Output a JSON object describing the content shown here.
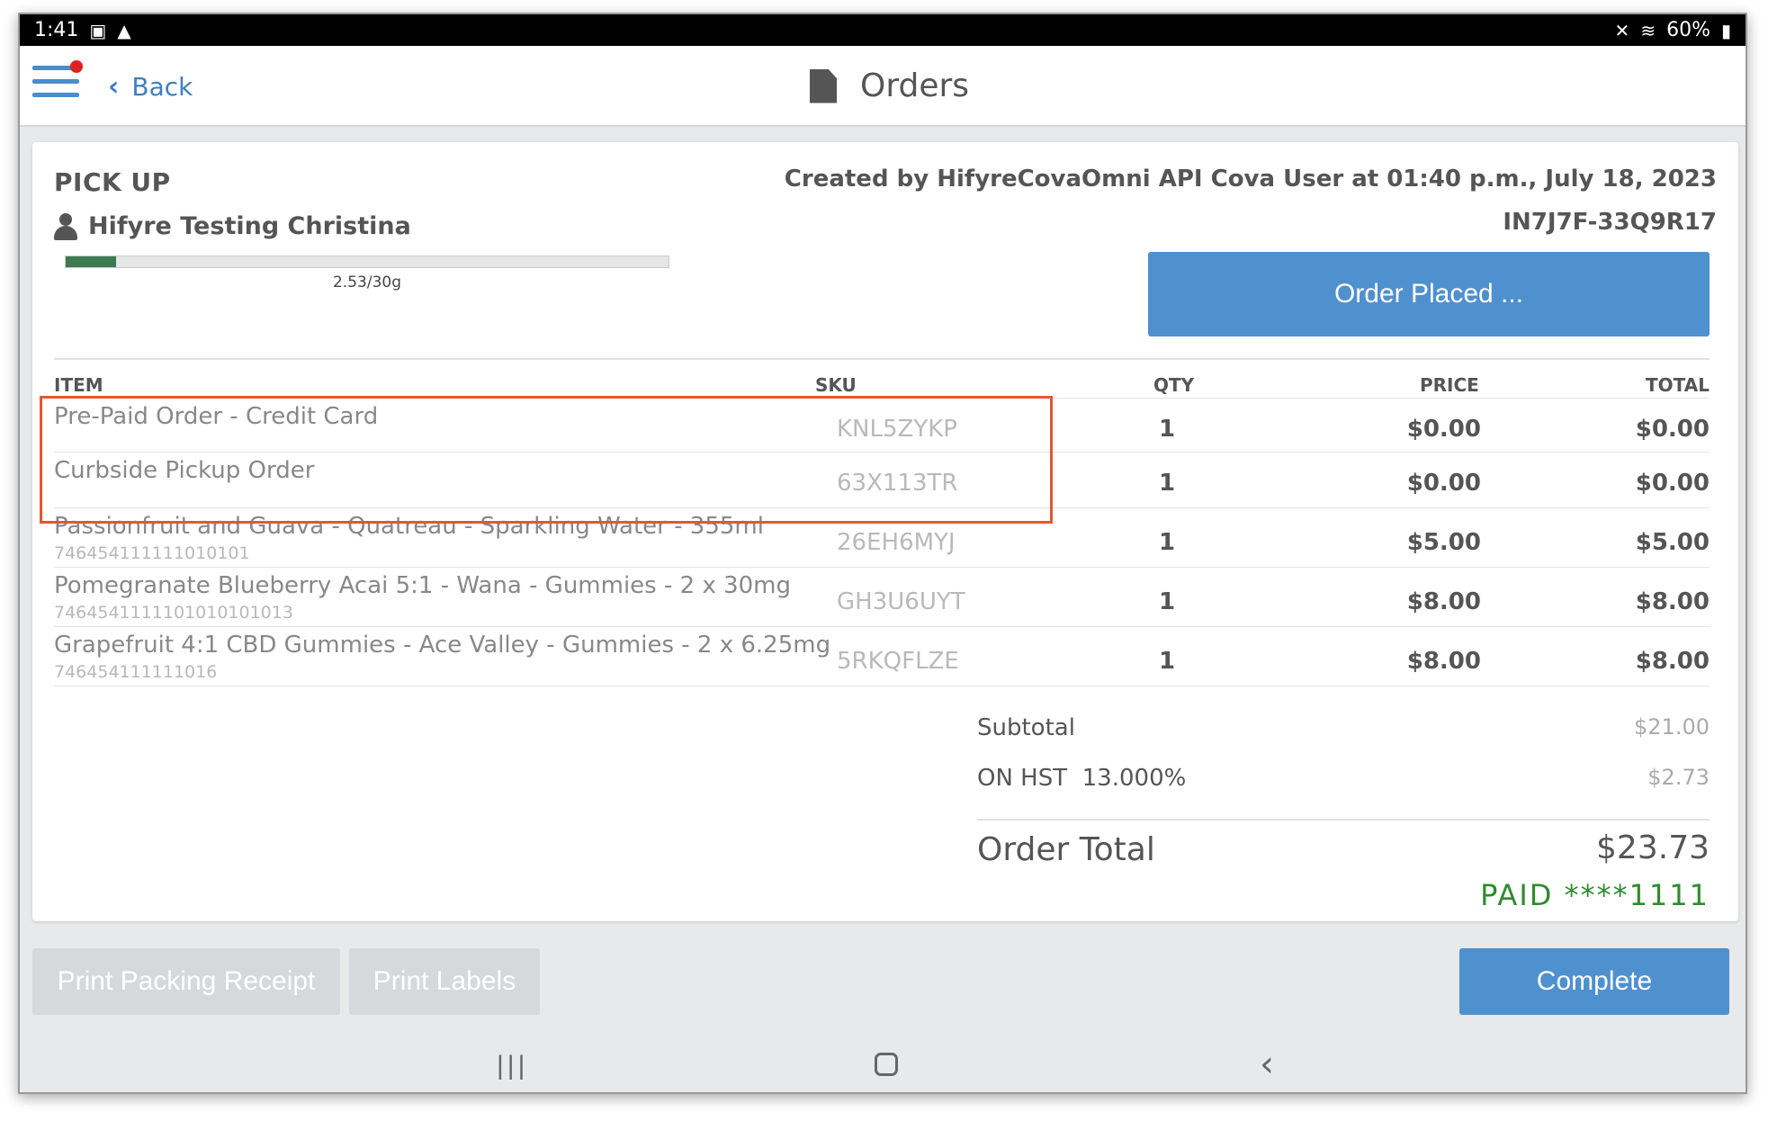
{
  "statusbar": {
    "time": "1:41",
    "battery": "60%"
  },
  "header": {
    "back_label": "Back",
    "title": "Orders"
  },
  "order": {
    "type_label": "PICK UP",
    "customer_name": "Hifyre Testing Christina",
    "progress_label": "2.53/30g",
    "progress_fraction": 0.0843,
    "created_text": "Created by HifyreCovaOmni API Cova User at 01:40 p.m., July 18, 2023",
    "order_code": "IN7J7F-33Q9R17",
    "status_button": "Order Placed ..."
  },
  "table": {
    "headers": {
      "item": "ITEM",
      "sku": "SKU",
      "qty": "QTY",
      "price": "PRICE",
      "total": "TOTAL"
    },
    "rows": [
      {
        "name": "Pre-Paid Order - Credit Card",
        "sub": "",
        "sku": "KNL5ZYKP",
        "qty": "1",
        "price": "$0.00",
        "total": "$0.00"
      },
      {
        "name": "Curbside Pickup Order",
        "sub": "",
        "sku": "63X113TR",
        "qty": "1",
        "price": "$0.00",
        "total": "$0.00"
      },
      {
        "name": "Passionfruit and Guava - Quatreau - Sparkling Water - 355ml",
        "sub": "746454111111010101",
        "sku": "26EH6MYJ",
        "qty": "1",
        "price": "$5.00",
        "total": "$5.00"
      },
      {
        "name": "Pomegranate Blueberry Acai 5:1 - Wana - Gummies - 2 x 30mg",
        "sub": "7464541111101010101013",
        "sku": "GH3U6UYT",
        "qty": "1",
        "price": "$8.00",
        "total": "$8.00"
      },
      {
        "name": "Grapefruit 4:1 CBD Gummies - Ace Valley - Gummies - 2 x 6.25mg",
        "sub": "746454111111016",
        "sku": "5RKQFLZE",
        "qty": "1",
        "price": "$8.00",
        "total": "$8.00"
      }
    ]
  },
  "totals": {
    "subtotal_label": "Subtotal",
    "subtotal_value": "$21.00",
    "tax_label": "ON HST  13.000%",
    "tax_value": "$2.73",
    "order_total_label": "Order Total",
    "order_total_value": "$23.73",
    "paid_text": "PAID ****1111"
  },
  "footer": {
    "print_packing_receipt": "Print Packing Receipt",
    "print_labels": "Print Labels",
    "complete": "Complete"
  },
  "colors": {
    "accent": "#4f90cf",
    "highlight": "#e4572e",
    "paid": "#2e8b2e"
  }
}
